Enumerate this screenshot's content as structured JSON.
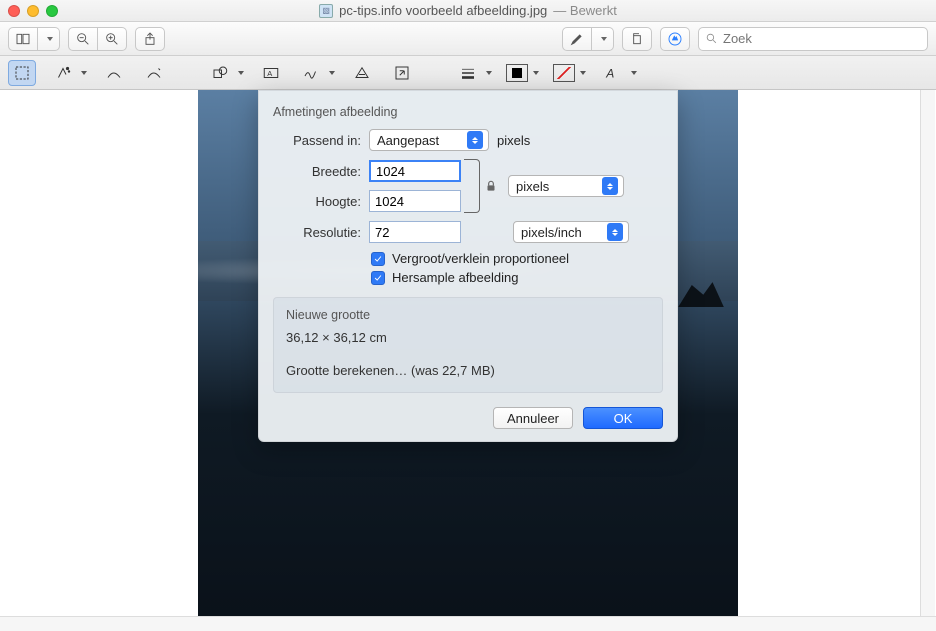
{
  "window": {
    "filename": "pc-tips.info voorbeeld afbeelding.jpg",
    "edited_label": "— Bewerkt"
  },
  "toolbar": {
    "search_placeholder": "Zoek"
  },
  "dialog": {
    "section_title": "Afmetingen afbeelding",
    "fit_label": "Passend in:",
    "fit_value": "Aangepast",
    "fit_unit_label": "pixels",
    "width_label": "Breedte:",
    "width_value": "1024",
    "height_label": "Hoogte:",
    "height_value": "1024",
    "wh_unit_value": "pixels",
    "resolution_label": "Resolutie:",
    "resolution_value": "72",
    "resolution_unit_value": "pixels/inch",
    "check_proportional": "Vergroot/verklein proportioneel",
    "check_resample": "Hersample afbeelding",
    "newsize_title": "Nieuwe grootte",
    "newsize_dims": "36,12 × 36,12 cm",
    "newsize_calc": "Grootte berekenen… (was 22,7 MB)",
    "cancel_label": "Annuleer",
    "ok_label": "OK"
  }
}
